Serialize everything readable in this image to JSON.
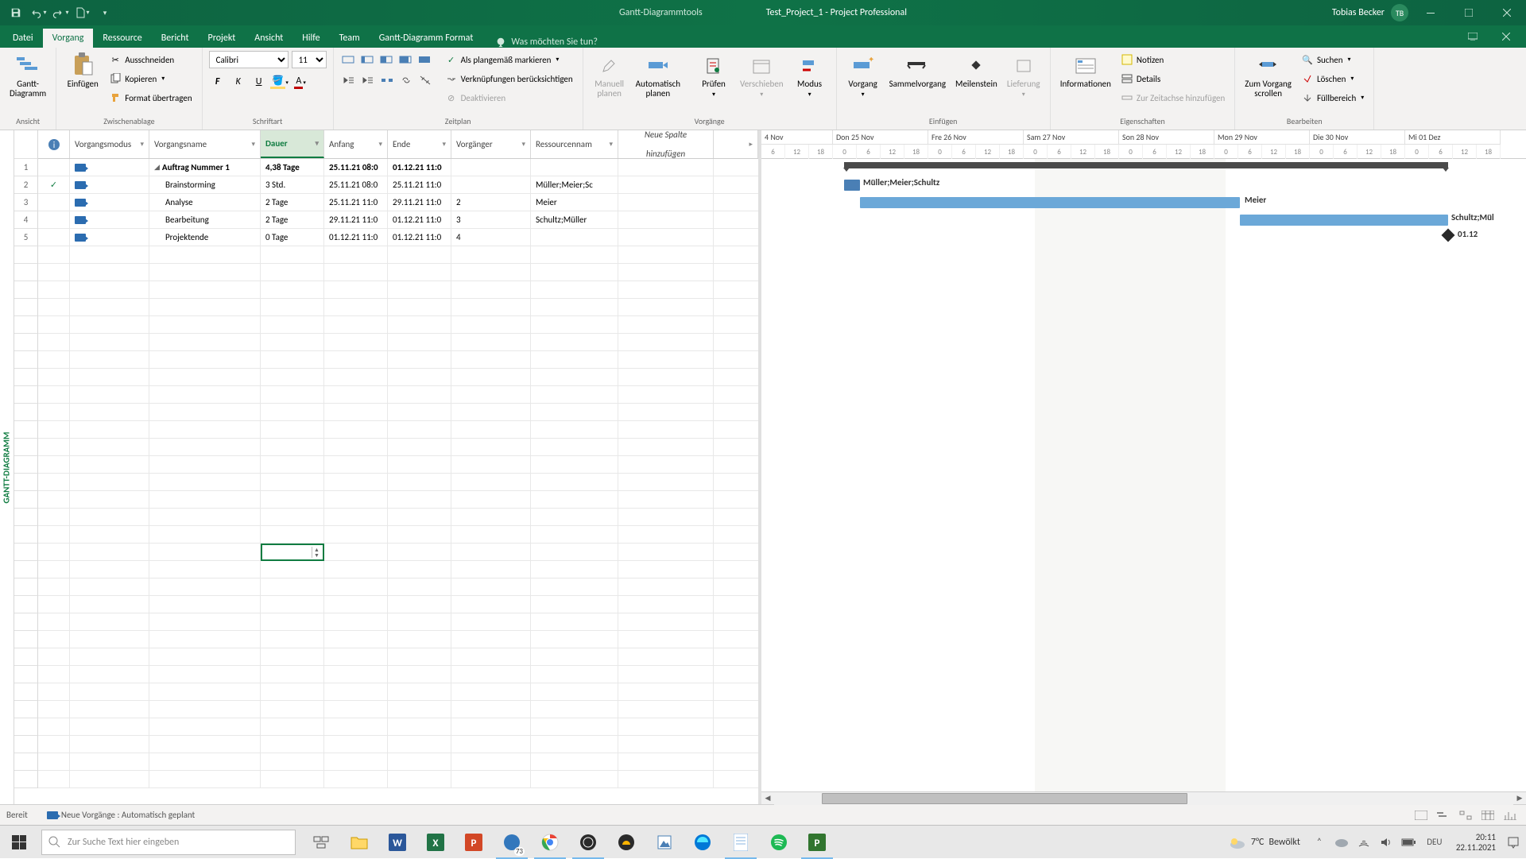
{
  "titlebar": {
    "tools_label": "Gantt-Diagrammtools",
    "file_title": "Test_Project_1 - Project Professional",
    "user_name": "Tobias Becker",
    "user_initials": "TB"
  },
  "tabs": {
    "file": "Datei",
    "task": "Vorgang",
    "resource": "Ressource",
    "report": "Bericht",
    "project": "Projekt",
    "view": "Ansicht",
    "help": "Hilfe",
    "team": "Team",
    "format": "Gantt-Diagramm Format",
    "tell_me": "Was möchten Sie tun?"
  },
  "ribbon": {
    "view_group": {
      "gantt_btn": "Gantt-\nDiagramm",
      "label": "Ansicht"
    },
    "clipboard": {
      "paste": "Einfügen",
      "cut": "Ausschneiden",
      "copy": "Kopieren",
      "format_painter": "Format übertragen",
      "label": "Zwischenablage"
    },
    "font": {
      "name": "Calibri",
      "size": "11",
      "label": "Schriftart"
    },
    "schedule": {
      "mark_on_track": "Als plangemäß markieren",
      "respect_links": "Verknüpfungen berücksichtigen",
      "deactivate": "Deaktivieren",
      "label": "Zeitplan"
    },
    "tasks": {
      "manual": "Manuell\nplanen",
      "auto": "Automatisch\nplanen",
      "inspect": "Prüfen",
      "move": "Verschieben",
      "mode": "Modus",
      "task_btn": "Vorgang",
      "summary": "Sammelvorgang",
      "milestone": "Meilenstein",
      "deliverable": "Lieferung",
      "info": "Informationen",
      "notes": "Notizen",
      "details": "Details",
      "add_timeline": "Zur Zeitachse hinzufügen",
      "label": "Vorgänge"
    },
    "props": {
      "label": "Eigenschaften"
    },
    "insert": {
      "scroll_to": "Zum Vorgang\nscrollen",
      "find": "Suchen",
      "clear": "Löschen",
      "fill": "Füllbereich",
      "label": "Bearbeiten"
    }
  },
  "grid": {
    "cols": {
      "info": "i",
      "mode": "Vorgangsmodus",
      "name": "Vorgangsname",
      "duration": "Dauer",
      "start": "Anfang",
      "finish": "Ende",
      "pred": "Vorgänger",
      "res": "Ressourcennam",
      "new_col_1": "Neue Spalte",
      "new_col_2": "hinzufügen"
    },
    "rows": [
      {
        "num": "1",
        "indicator": "",
        "name": "Auftrag Nummer 1",
        "bold": true,
        "summary": true,
        "dur": "4,38 Tage",
        "start": "25.11.21 08:0",
        "finish": "01.12.21 11:0",
        "pred": "",
        "res": ""
      },
      {
        "num": "2",
        "indicator": "✓",
        "name": "Brainstorming",
        "dur": "3 Std.",
        "start": "25.11.21 08:0",
        "finish": "25.11.21 11:0",
        "pred": "",
        "res": "Müller;Meier;Sc"
      },
      {
        "num": "3",
        "indicator": "",
        "name": "Analyse",
        "dur": "2 Tage",
        "start": "25.11.21 11:0",
        "finish": "29.11.21 11:0",
        "pred": "2",
        "res": "Meier"
      },
      {
        "num": "4",
        "indicator": "",
        "name": "Bearbeitung",
        "dur": "2 Tage",
        "start": "29.11.21 11:0",
        "finish": "01.12.21 11:0",
        "pred": "3",
        "res": "Schultz;Müller"
      },
      {
        "num": "5",
        "indicator": "",
        "name": "Projektende",
        "dur": "0 Tage",
        "start": "01.12.21 11:0",
        "finish": "01.12.21 11:0",
        "pred": "4",
        "res": ""
      }
    ]
  },
  "timeline": {
    "part_first": "4 Nov",
    "days": [
      "Don 25 Nov",
      "Fre 26 Nov",
      "Sam 27 Nov",
      "Son 28 Nov",
      "Mon 29 Nov",
      "Die 30 Nov",
      "Mi 01 Dez"
    ],
    "hours": [
      "6",
      "12",
      "18",
      "0",
      "6",
      "12",
      "18",
      "0",
      "6",
      "12",
      "18",
      "0",
      "6",
      "12",
      "18",
      "0",
      "6",
      "12",
      "18",
      "0",
      "6",
      "12",
      "18",
      "0",
      "6",
      "12",
      "18",
      "0",
      "6",
      "12",
      "18"
    ]
  },
  "gantt_labels": {
    "r2": "Müller;Meier;Schultz",
    "r3": "Meier",
    "r4": "Schultz;Mül",
    "r5": "01.12"
  },
  "side_label": "GANTT-DIAGRAMM",
  "statusbar": {
    "ready": "Bereit",
    "new_tasks": "Neue Vorgänge : Automatisch geplant"
  },
  "taskbar": {
    "search_placeholder": "Zur Suche Text hier eingeben",
    "weather_temp": "7°C",
    "weather_text": "Bewölkt",
    "lang": "DEU",
    "time": "20:11",
    "date": "22.11.2021",
    "tb_badge": "73"
  }
}
